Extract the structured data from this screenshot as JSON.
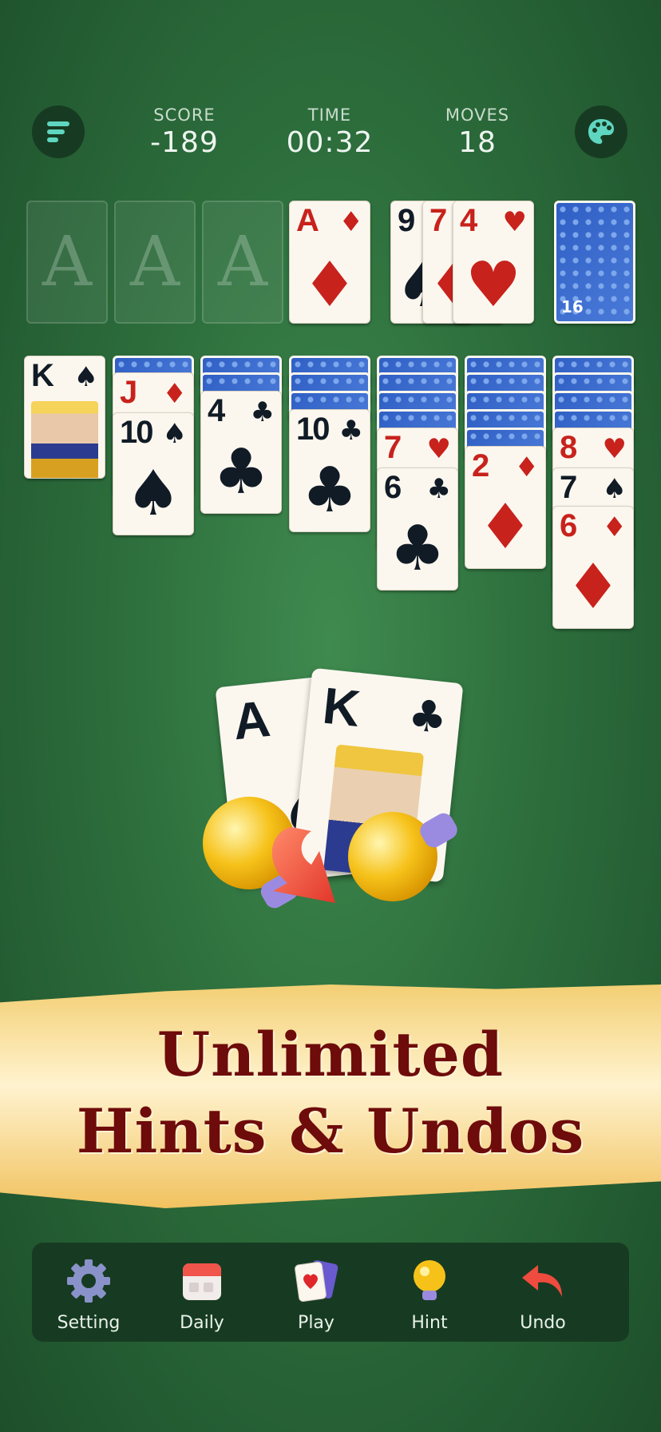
{
  "header": {
    "menu_icon": "menu-icon",
    "theme_icon": "palette-icon",
    "score_label": "SCORE",
    "score_value": "-189",
    "time_label": "TIME",
    "time_value": "00:32",
    "moves_label": "MOVES",
    "moves_value": "18"
  },
  "foundations": [
    {
      "placeholder": "A"
    },
    {
      "placeholder": "A"
    },
    {
      "placeholder": "A"
    },
    {
      "rank": "A",
      "suit": "♦"
    }
  ],
  "waste": [
    {
      "rank": "9",
      "suit": "♠"
    },
    {
      "rank": "7",
      "suit": "♦"
    },
    {
      "rank": "4",
      "suit": "♥"
    }
  ],
  "stock": {
    "count": "16"
  },
  "tableau": [
    {
      "face_down": 0,
      "cards": [
        {
          "rank": "K",
          "suit": "♠"
        }
      ]
    },
    {
      "face_down": 1,
      "cards": [
        {
          "rank": "J",
          "suit": "♦"
        },
        {
          "rank": "10",
          "suit": "♠"
        }
      ]
    },
    {
      "face_down": 2,
      "cards": [
        {
          "rank": "4",
          "suit": "♣"
        }
      ]
    },
    {
      "face_down": 3,
      "cards": [
        {
          "rank": "10",
          "suit": "♣"
        }
      ]
    },
    {
      "face_down": 4,
      "cards": [
        {
          "rank": "7",
          "suit": "♥"
        },
        {
          "rank": "6",
          "suit": "♣"
        }
      ]
    },
    {
      "face_down": 5,
      "cards": [
        {
          "rank": "2",
          "suit": "♦"
        }
      ]
    },
    {
      "face_down": 4,
      "cards": [
        {
          "rank": "8",
          "suit": "♥"
        },
        {
          "rank": "7",
          "suit": "♠"
        },
        {
          "rank": "6",
          "suit": "♦"
        }
      ]
    }
  ],
  "promo": {
    "card_left": {
      "rank": "A",
      "suit": "♠"
    },
    "card_right": {
      "rank": "K",
      "suit": "♣"
    },
    "line1": "Unlimited",
    "line2": "Hints & Undos"
  },
  "toolbar": [
    {
      "label": "Setting",
      "icon": "gear-icon"
    },
    {
      "label": "Daily",
      "icon": "calendar-icon"
    },
    {
      "label": "Play",
      "icon": "cards-icon"
    },
    {
      "label": "Hint",
      "icon": "lightbulb-icon"
    },
    {
      "label": "Undo",
      "icon": "undo-arrow-icon"
    }
  ],
  "colors": {
    "felt": "#2d6e3c",
    "panel": "#173b22",
    "red_suit": "#c8221c",
    "black_suit": "#111b26",
    "banner_text": "#6e0b0b"
  }
}
